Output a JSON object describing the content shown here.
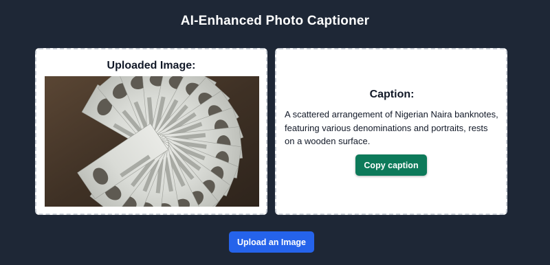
{
  "app": {
    "title": "AI-Enhanced Photo Captioner"
  },
  "upload_panel": {
    "heading": "Uploaded Image:",
    "image_description": "Nigerian Naira banknotes fanned out on a wooden surface"
  },
  "caption_panel": {
    "heading": "Caption:",
    "caption": "A scattered arrangement of Nigerian Naira banknotes, featuring various denominations and portraits, rests on a wooden surface.",
    "copy_label": "Copy caption"
  },
  "actions": {
    "upload_label": "Upload an Image"
  },
  "colors": {
    "background": "#1e2736",
    "panel": "#ffffff",
    "copy_button": "#0d7a5a",
    "upload_button": "#2563eb"
  }
}
